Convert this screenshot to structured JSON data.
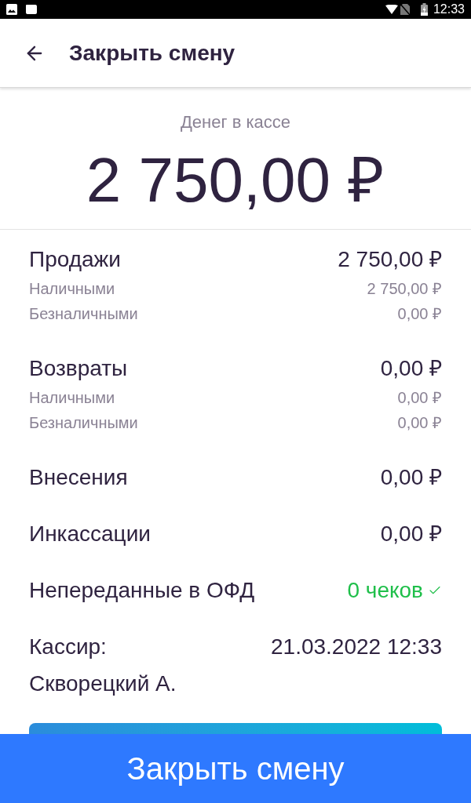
{
  "status_bar": {
    "time": "12:33"
  },
  "app_bar": {
    "title": "Закрыть смену"
  },
  "cash": {
    "label": "Денег в кассе",
    "amount": "2 750,00 ₽"
  },
  "sections": [
    {
      "kind": "group",
      "label": "Продажи",
      "value": "2 750,00 ₽",
      "details": [
        {
          "label": "Наличными",
          "value": "2 750,00 ₽"
        },
        {
          "label": "Безналичными",
          "value": "0,00 ₽"
        }
      ]
    },
    {
      "kind": "group",
      "label": "Возвраты",
      "value": "0,00 ₽",
      "details": [
        {
          "label": "Наличными",
          "value": "0,00 ₽"
        },
        {
          "label": "Безналичными",
          "value": "0,00 ₽"
        }
      ]
    },
    {
      "kind": "simple",
      "label": "Внесения",
      "value": "0,00 ₽"
    },
    {
      "kind": "simple",
      "label": "Инкассации",
      "value": "0,00 ₽"
    },
    {
      "kind": "status",
      "label": "Непереданные в ОФД",
      "value": "0 чеков",
      "ok": true
    }
  ],
  "cashier": {
    "label": "Кассир:",
    "name": "Скворецкий А.",
    "datetime": "21.03.2022 12:33"
  },
  "bottom_bar": {
    "button": "Закрыть смену"
  }
}
